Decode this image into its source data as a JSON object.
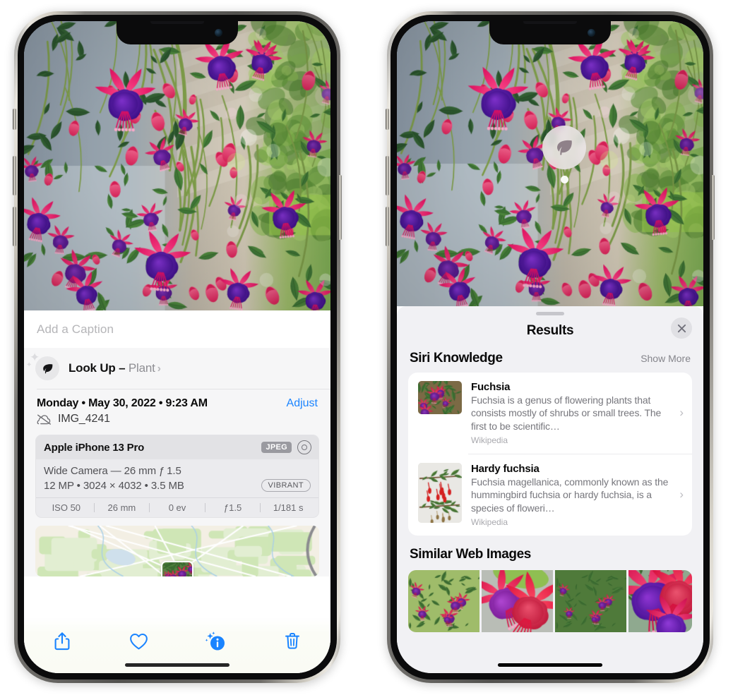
{
  "left_phone": {
    "caption_placeholder": "Add a Caption",
    "lookup": {
      "label": "Look Up",
      "dash": " – ",
      "subject": "Plant",
      "chevron": "›",
      "icon": "leaf-icon"
    },
    "date_line": "Monday • May 30, 2022 • 9:23 AM",
    "adjust_label": "Adjust",
    "file_name": "IMG_4241",
    "metadata": {
      "device": "Apple iPhone 13 Pro",
      "format_badge": "JPEG",
      "lens_line": "Wide Camera — 26 mm ƒ 1.5",
      "size_line": "12 MP • 3024 × 4032 • 3.5 MB",
      "style_badge": "VIBRANT",
      "exif": [
        "ISO 50",
        "26 mm",
        "0 ev",
        "ƒ1.5",
        "1/181 s"
      ]
    },
    "toolbar": [
      {
        "name": "share-button",
        "icon": "share-icon"
      },
      {
        "name": "favorite-button",
        "icon": "heart-icon"
      },
      {
        "name": "info-button",
        "icon": "info-sparkle-icon"
      },
      {
        "name": "delete-button",
        "icon": "trash-icon"
      }
    ]
  },
  "right_phone": {
    "marker": {
      "icon": "leaf-icon"
    },
    "sheet_title": "Results",
    "close_label": "×",
    "siri_knowledge": {
      "title": "Siri Knowledge",
      "show_more": "Show More",
      "items": [
        {
          "title": "Fuchsia",
          "description": "Fuchsia is a genus of flowering plants that consists mostly of shrubs or small trees. The first to be scientific…",
          "source": "Wikipedia",
          "chevron": "›"
        },
        {
          "title": "Hardy fuchsia",
          "description": "Fuchsia magellanica, commonly known as the hummingbird fuchsia or hardy fuchsia, is a species of floweri…",
          "source": "Wikipedia",
          "chevron": "›"
        }
      ]
    },
    "similar_web_images": {
      "title": "Similar Web Images",
      "count": 4
    }
  },
  "colors": {
    "accent_blue": "#1a84ff",
    "sheet_bg": "#f1f1f4",
    "card_bg": "#ffffff",
    "secondary_text": "#8e8e93",
    "meta_card_bg": "#ebebee"
  }
}
